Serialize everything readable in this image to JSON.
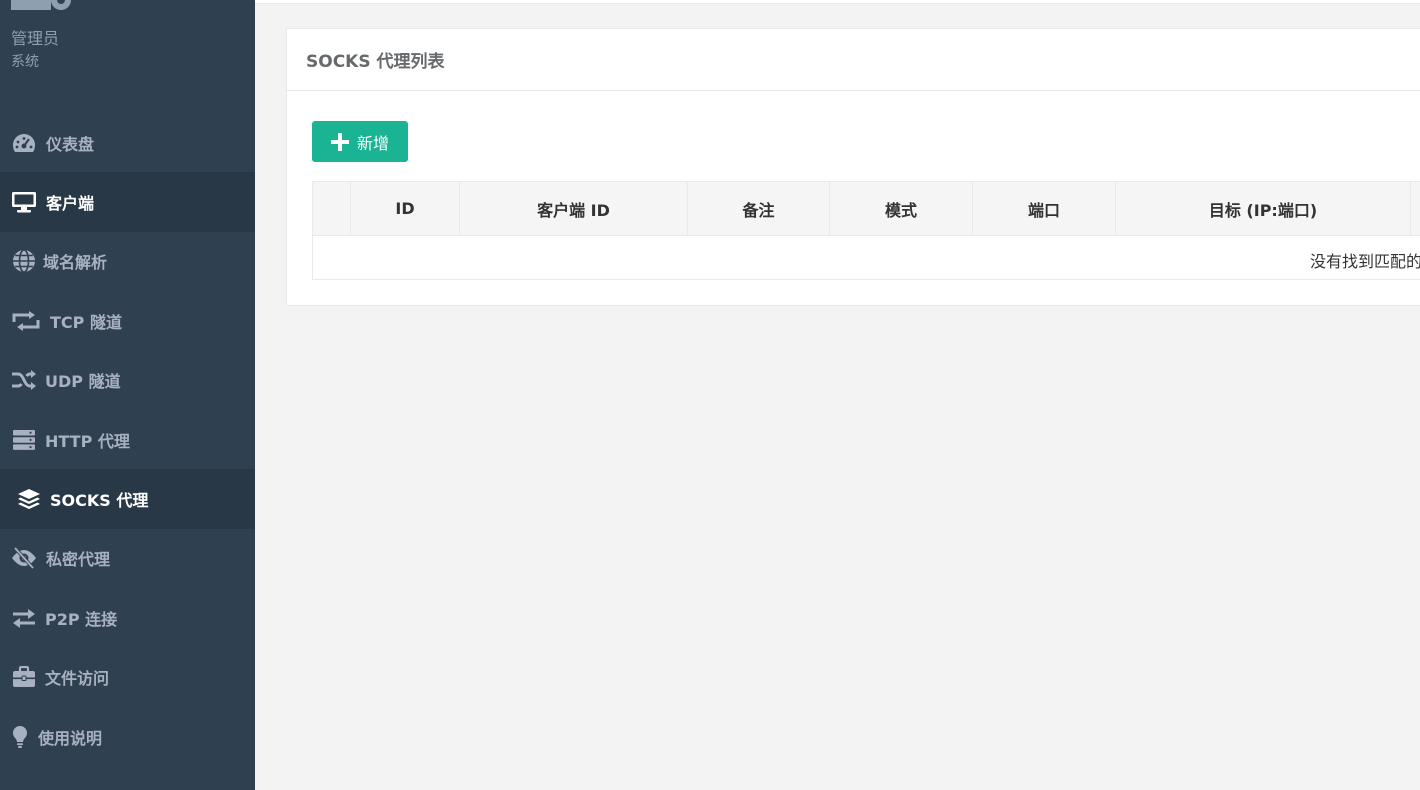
{
  "profile": {
    "name": "管理员",
    "role": "系统"
  },
  "sidebar": {
    "items": [
      {
        "label": "仪表盘",
        "icon": "dashboard-icon",
        "active": false
      },
      {
        "label": "客户端",
        "icon": "desktop-icon",
        "active": true
      },
      {
        "label": "域名解析",
        "icon": "globe-icon",
        "active": false
      },
      {
        "label": "TCP 隧道",
        "icon": "retweet-icon",
        "active": false
      },
      {
        "label": "UDP 隧道",
        "icon": "random-icon",
        "active": false
      },
      {
        "label": "HTTP 代理",
        "icon": "server-icon",
        "active": false
      },
      {
        "label": "SOCKS 代理",
        "icon": "layers-icon",
        "active": true
      },
      {
        "label": "私密代理",
        "icon": "eye-slash-icon",
        "active": false
      },
      {
        "label": "P2P 连接",
        "icon": "exchange-icon",
        "active": false
      },
      {
        "label": "文件访问",
        "icon": "briefcase-icon",
        "active": false
      },
      {
        "label": "使用说明",
        "icon": "lightbulb-icon",
        "active": false
      }
    ]
  },
  "panel": {
    "title": "SOCKS 代理列表",
    "add_label": "新增"
  },
  "table": {
    "columns": [
      "ID",
      "客户端 ID",
      "备注",
      "模式",
      "端口",
      "目标 (IP:端口)"
    ],
    "empty_text": "没有找到匹配的"
  },
  "colors": {
    "sidebar_bg": "#2f4050",
    "sidebar_active_bg": "#293846",
    "accent": "#1ab394"
  }
}
